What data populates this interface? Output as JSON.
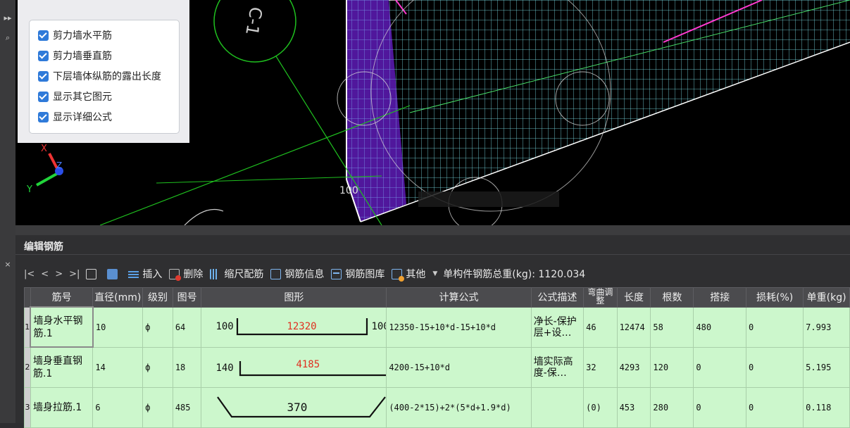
{
  "options": {
    "items": [
      {
        "label": "剪力墙水平筋",
        "checked": true
      },
      {
        "label": "剪力墙垂直筋",
        "checked": true
      },
      {
        "label": "下层墙体纵筋的露出长度",
        "checked": true
      },
      {
        "label": "显示其它图元",
        "checked": true
      },
      {
        "label": "显示详细公式",
        "checked": true
      }
    ]
  },
  "viewport": {
    "axis_x": "X",
    "axis_y": "Y",
    "axis_z": "Z",
    "dim_100": "100",
    "section_label": "C-1"
  },
  "panel": {
    "title": "编辑钢筋"
  },
  "toolbar": {
    "nav_first": "|<",
    "nav_prev": "<",
    "nav_next": ">",
    "nav_last": ">|",
    "insert": "插入",
    "delete": "删除",
    "scale": "缩尺配筋",
    "info": "钢筋信息",
    "library": "钢筋图库",
    "other": "其他",
    "total": "单构件钢筋总重(kg): 1120.034"
  },
  "table": {
    "headers": [
      "筋号",
      "直径(mm)",
      "级别",
      "图号",
      "图形",
      "计算公式",
      "公式描述",
      "弯曲调整",
      "长度",
      "根数",
      "搭接",
      "损耗(%)",
      "单重(kg)"
    ],
    "rows": [
      {
        "num": "1",
        "name": "墙身水平钢筋.1",
        "dia": "10",
        "grade": "ф",
        "fig": "64",
        "shape_left": "100",
        "shape_mid": "12320",
        "shape_right": "100",
        "formula": "12350-15+10*d-15+10*d",
        "desc": "净长-保护层+设…",
        "bend": "46",
        "length": "12474",
        "count": "58",
        "lap": "480",
        "loss": "0",
        "weight": "7.993"
      },
      {
        "num": "2",
        "name": "墙身垂直钢筋.1",
        "dia": "14",
        "grade": "ф",
        "fig": "18",
        "shape_left": "140",
        "shape_mid": "4185",
        "shape_right": "",
        "formula": "4200-15+10*d",
        "desc": "墙实际高度-保…",
        "bend": "32",
        "length": "4293",
        "count": "120",
        "lap": "0",
        "loss": "0",
        "weight": "5.195"
      },
      {
        "num": "3",
        "name": "墙身拉筋.1",
        "dia": "6",
        "grade": "ф",
        "fig": "485",
        "shape_left": "",
        "shape_mid": "370",
        "shape_right": "",
        "formula": "(400-2*15)+2*(5*d+1.9*d)",
        "desc": "",
        "bend": "(0)",
        "length": "453",
        "count": "280",
        "lap": "0",
        "loss": "0",
        "weight": "0.118"
      }
    ]
  },
  "colors": {
    "viewport_bg": "#000000",
    "row_bg": "#ccf7cc",
    "accent": "#2f7ad9",
    "rebar_red": "#e03020"
  }
}
